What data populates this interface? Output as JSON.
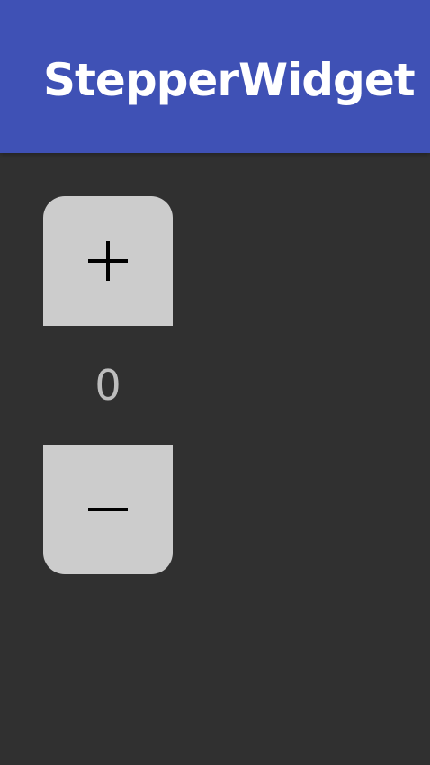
{
  "app_bar": {
    "title": "StepperWidget",
    "color": "#3F51B5"
  },
  "stepper": {
    "increment_icon": "plus-icon",
    "decrement_icon": "minus-icon",
    "value": "0",
    "button_color": "#CCCCCC",
    "value_color": "#BDBDBD"
  },
  "background_color": "#303030"
}
